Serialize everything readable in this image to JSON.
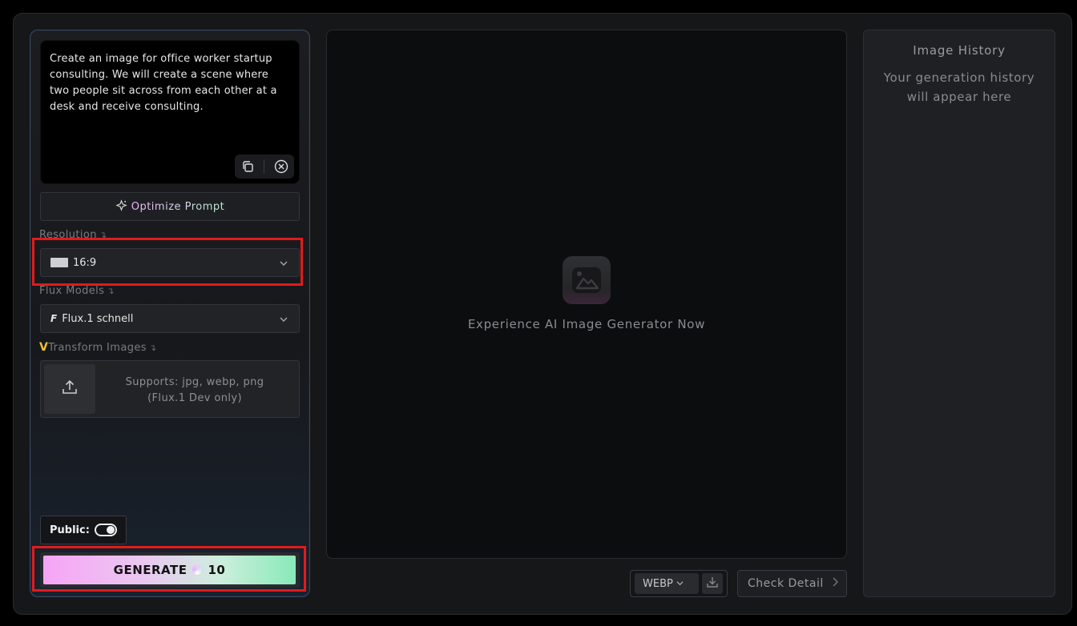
{
  "prompt": {
    "text": "Create an image for office worker startup consulting. We will create a scene where two people sit across from each other at a desk and receive consulting.",
    "copy_icon": "copy-icon",
    "clear_icon": "clear-circle-icon"
  },
  "optimize": {
    "label": "Optimize Prompt",
    "icon": "sparkle-icon"
  },
  "resolution": {
    "label": "Resolution",
    "value": "16:9"
  },
  "models": {
    "label": "Flux Models",
    "value": "Flux.1 schnell"
  },
  "transform": {
    "label": "Transform Images",
    "badge": "V",
    "upload_text": "Supports: jpg, webp, png\n(Flux.1 Dev only)"
  },
  "public": {
    "label": "Public:",
    "enabled": true
  },
  "generate": {
    "label": "GENERATE",
    "cost": "10"
  },
  "canvas": {
    "placeholder": "Experience AI Image Generator Now"
  },
  "output": {
    "format": "WEBP",
    "check_detail": "Check Detail"
  },
  "history": {
    "title": "Image History",
    "empty": "Your generation history will appear here"
  },
  "colors": {
    "accent_red": "#e01b1b",
    "generate_gradient_start": "#f7a4f6",
    "generate_gradient_end": "#88eab8"
  }
}
